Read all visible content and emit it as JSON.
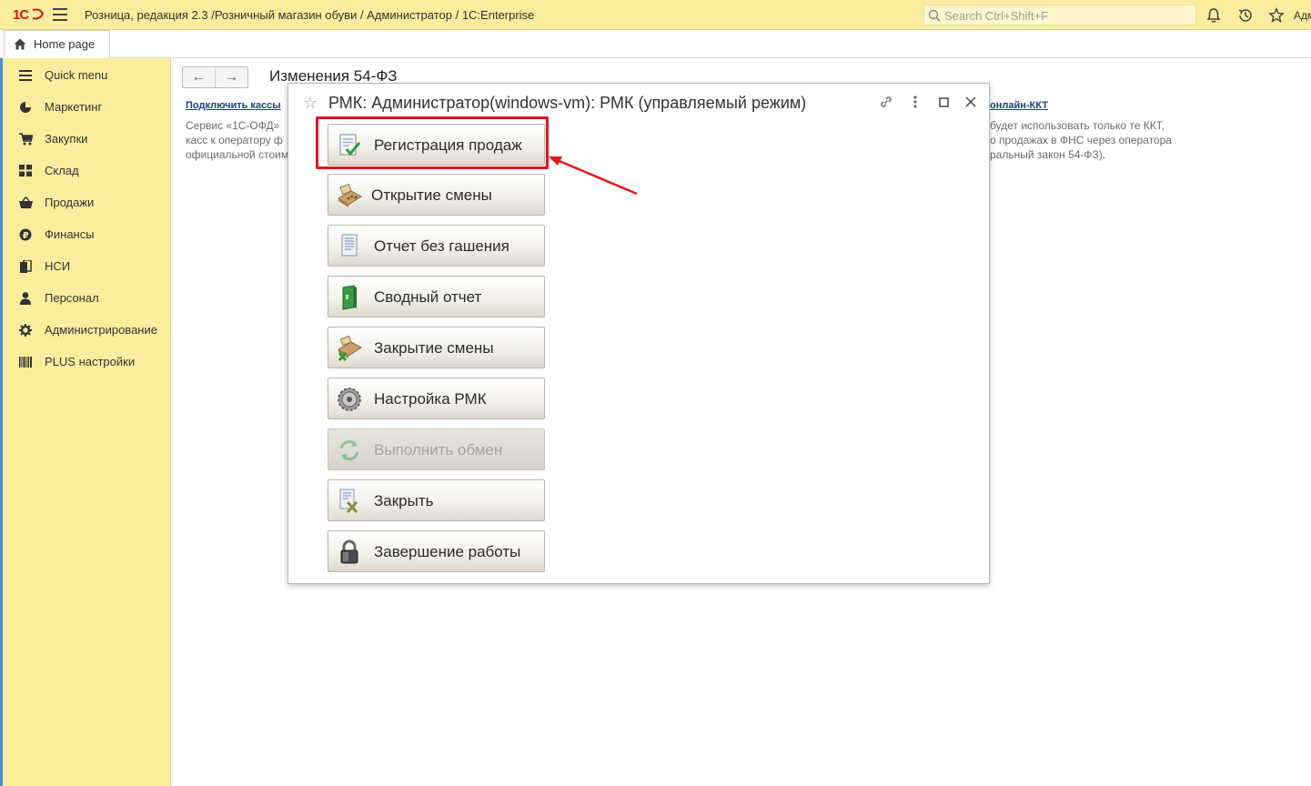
{
  "topbar": {
    "logo_text": "1С",
    "title": "Розница, редакция 2.3 /Розничный магазин обуви / Администратор / 1С:Enterprise",
    "search_placeholder": "Search Ctrl+Shift+F",
    "user_text": "Адм",
    "icons": [
      "bell-icon",
      "history-icon",
      "star-icon"
    ]
  },
  "tabs": {
    "home_label": "Home page"
  },
  "sidebar": {
    "items": [
      {
        "label": "Quick menu",
        "icon": "menu-icon"
      },
      {
        "label": "Маркетинг",
        "icon": "pie-chart-icon"
      },
      {
        "label": "Закупки",
        "icon": "cart-icon"
      },
      {
        "label": "Склад",
        "icon": "warehouse-icon"
      },
      {
        "label": "Продажи",
        "icon": "basket-icon"
      },
      {
        "label": "Финансы",
        "icon": "ruble-icon"
      },
      {
        "label": "НСИ",
        "icon": "books-icon"
      },
      {
        "label": "Персонал",
        "icon": "person-icon"
      },
      {
        "label": "Администрирование",
        "icon": "gear-icon"
      },
      {
        "label": "PLUS настройки",
        "icon": "barcode-icon"
      }
    ]
  },
  "page": {
    "heading": "Изменения 54-ФЗ",
    "link_left": "Подключить кассы",
    "text_left": [
      "Сервис «1С-ОФД»",
      "касс к оператору ф",
      "официальной стоим"
    ],
    "link_right": "онлайн-ККТ",
    "text_right": [
      "будет использовать только те ККТ,",
      "о продажах в ФНС через оператора",
      "ральный закон 54-ФЗ)."
    ]
  },
  "modal": {
    "title": "РМК: Администратор(windows-vm): РМК (управляемый режим)",
    "buttons": [
      {
        "label": "Регистрация продаж",
        "icon": "sales-register-icon",
        "enabled": true
      },
      {
        "label": "Открытие смены",
        "icon": "cash-register-icon",
        "enabled": true
      },
      {
        "label": "Отчет без гашения",
        "icon": "report-document-icon",
        "enabled": true
      },
      {
        "label": "Сводный отчет",
        "icon": "summary-book-icon",
        "enabled": true
      },
      {
        "label": "Закрытие смены",
        "icon": "cash-register-close-icon",
        "enabled": true
      },
      {
        "label": "Настройка РМК",
        "icon": "settings-disc-icon",
        "enabled": true
      },
      {
        "label": "Выполнить обмен",
        "icon": "exchange-icon",
        "enabled": false
      },
      {
        "label": "Закрыть",
        "icon": "close-document-icon",
        "enabled": true
      },
      {
        "label": "Завершение работы",
        "icon": "lock-icon",
        "enabled": true
      }
    ]
  },
  "annotation": {
    "highlight_color": "#e4151c"
  }
}
